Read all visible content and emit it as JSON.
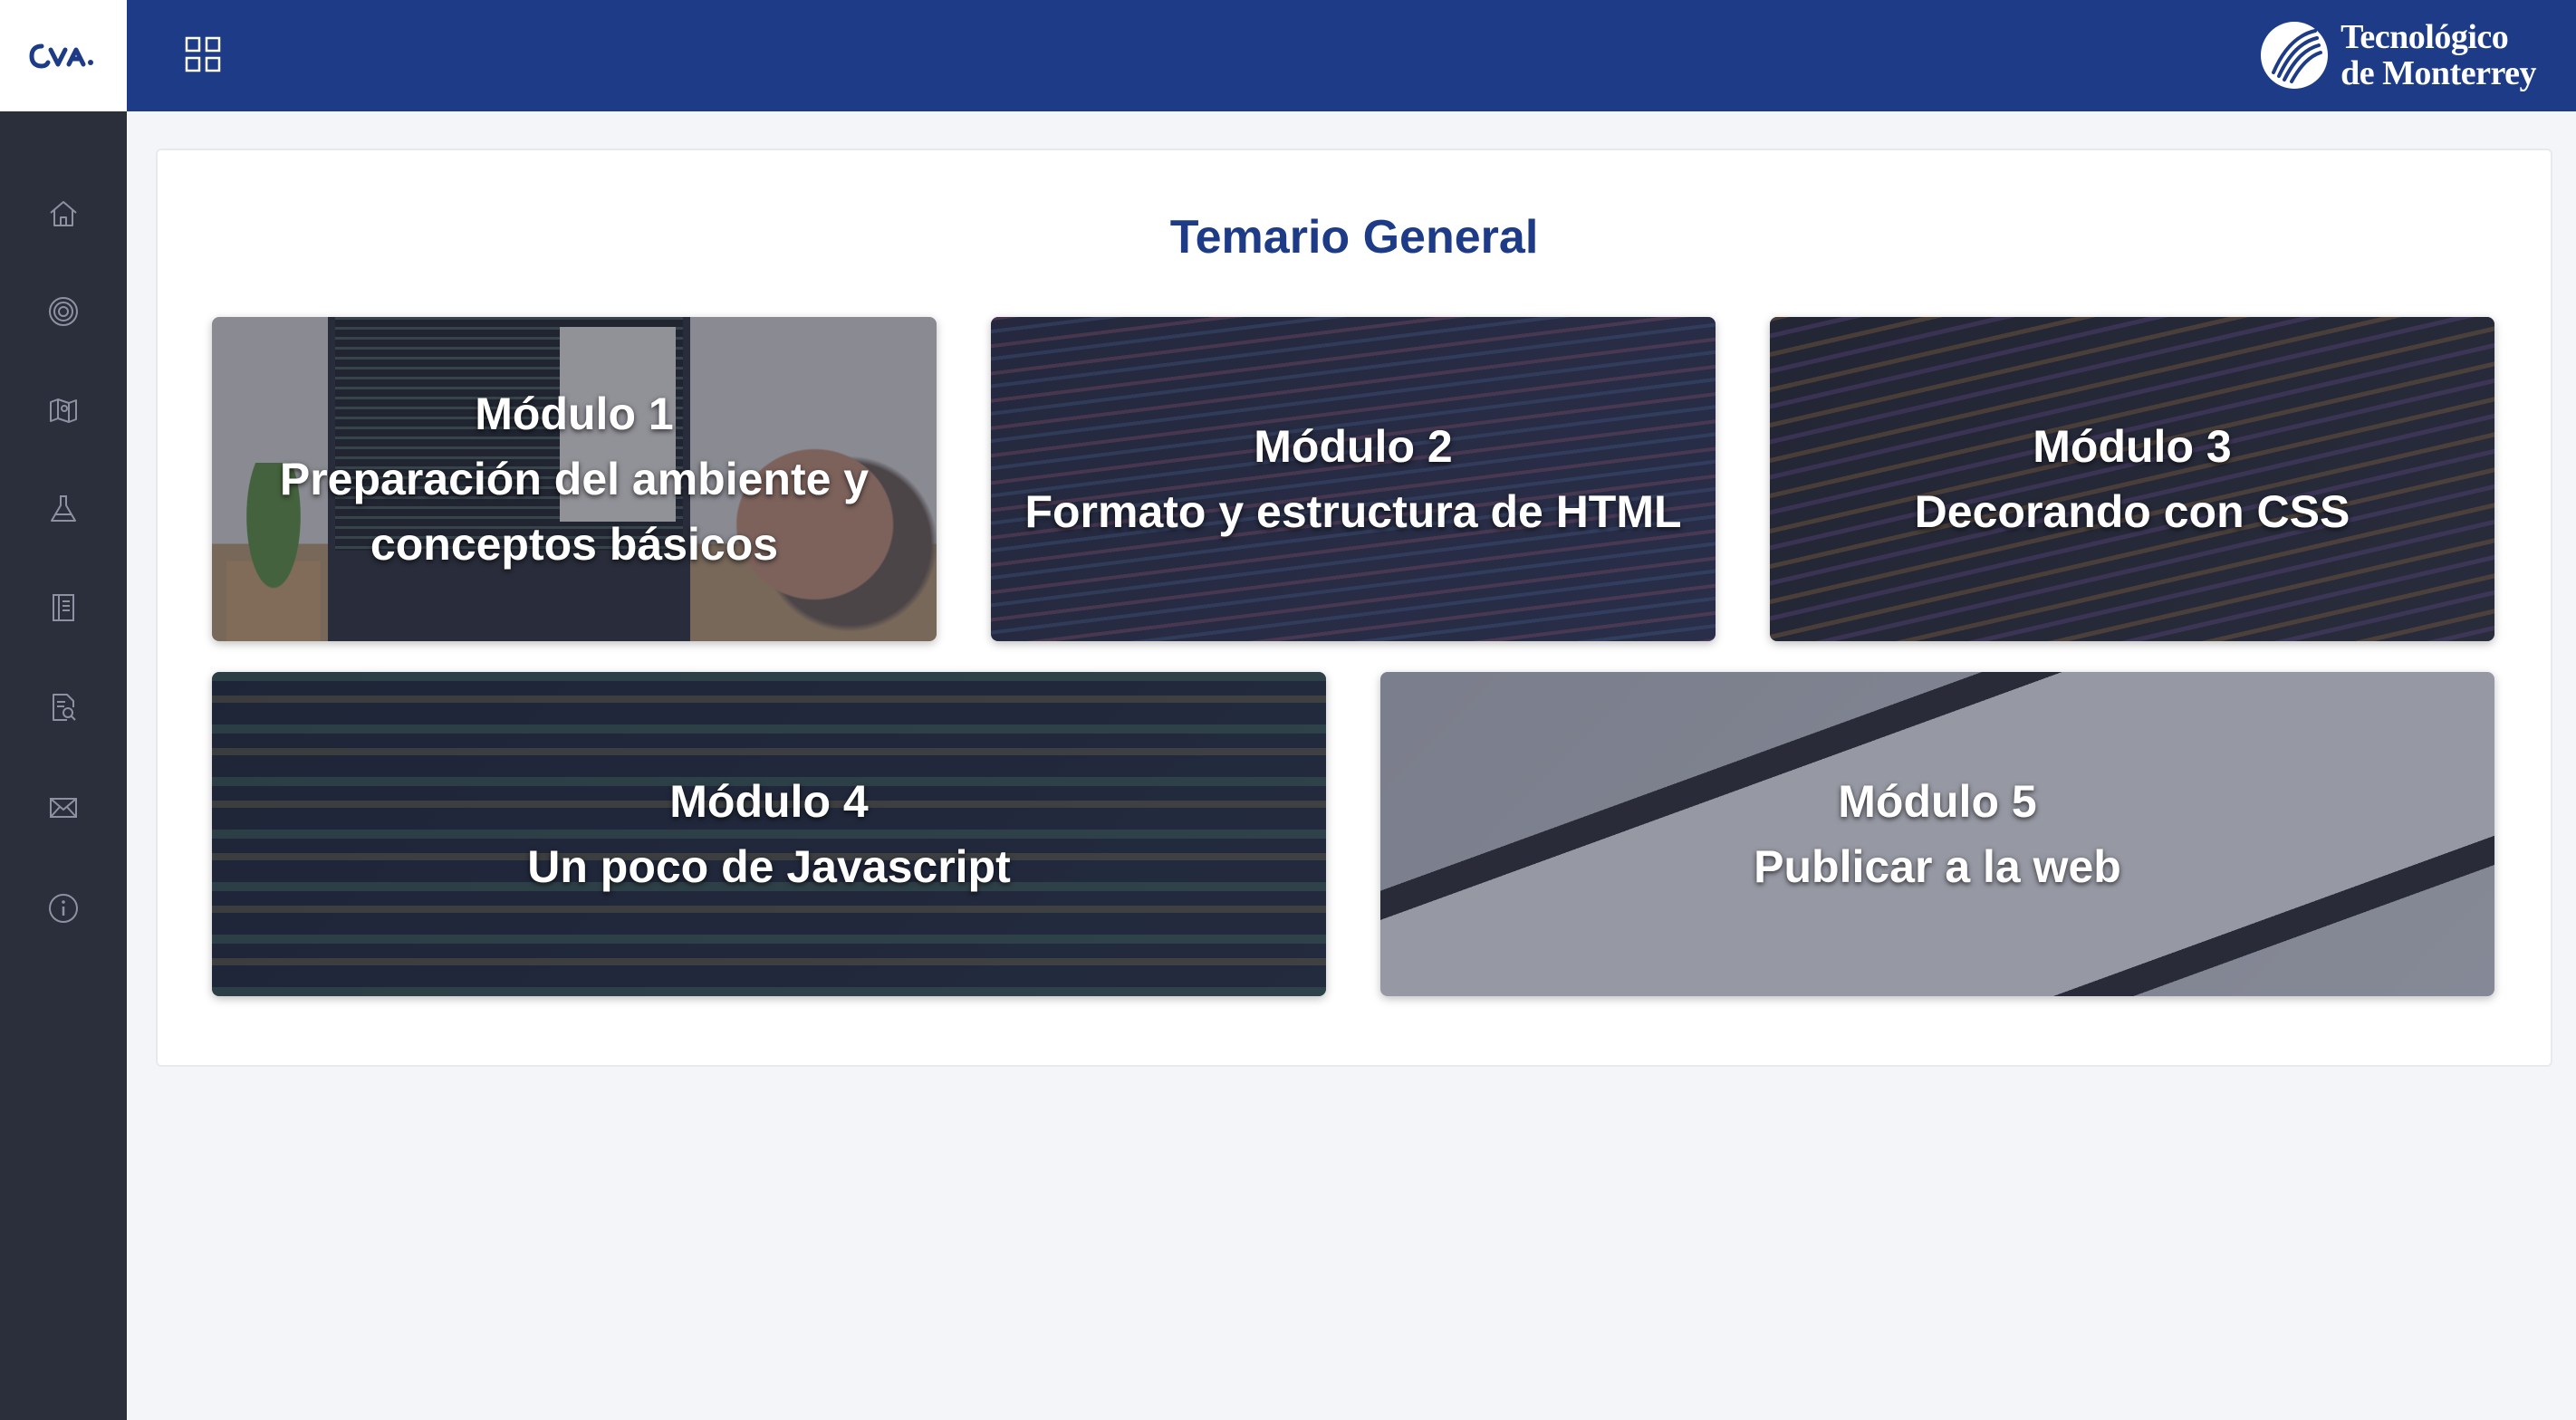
{
  "sidebar": {
    "logo_text": "CVA",
    "items": [
      {
        "icon": "home-icon"
      },
      {
        "icon": "target-icon"
      },
      {
        "icon": "map-icon"
      },
      {
        "icon": "lab-flask-icon"
      },
      {
        "icon": "notebook-icon"
      },
      {
        "icon": "document-search-icon"
      },
      {
        "icon": "mail-icon"
      },
      {
        "icon": "info-icon"
      }
    ]
  },
  "header": {
    "apps_icon": "grid-icon",
    "brand_line1": "Tecnológico",
    "brand_line2": "de Monterrey",
    "background_color": "#1d3b86"
  },
  "main": {
    "title": "Temario General",
    "modules": [
      {
        "number": "Módulo 1",
        "line1": "Preparación del ambiente y",
        "line2": "conceptos básicos"
      },
      {
        "number": "Módulo 2",
        "line1": "Formato y estructura de HTML"
      },
      {
        "number": "Módulo 3",
        "line1": "Decorando con CSS"
      },
      {
        "number": "Módulo 4",
        "line1": "Un poco de Javascript"
      },
      {
        "number": "Módulo 5",
        "line1": "Publicar a la web"
      }
    ]
  },
  "colors": {
    "accent": "#1d3b86",
    "sidebar": "#2b2e3b",
    "page_background": "#f3f5f8"
  }
}
